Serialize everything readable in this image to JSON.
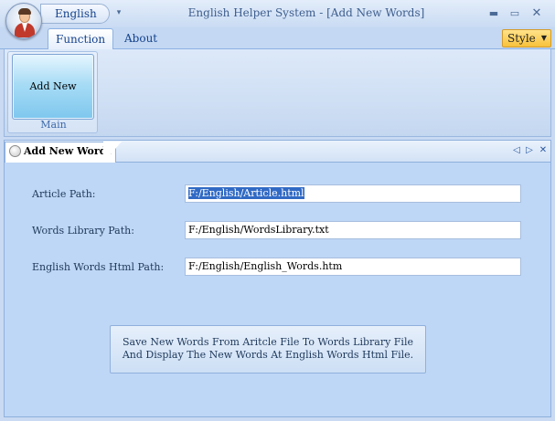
{
  "window": {
    "title": "English Helper System - [Add New Words]",
    "minimize_icon": "minimize-icon",
    "maximize_icon": "maximize-icon",
    "close_icon": "close-icon"
  },
  "quick_access": {
    "language_label": "English",
    "dropdown_icon": "customize-arrow-icon"
  },
  "ribbon": {
    "tabs": [
      {
        "label": "Function",
        "active": true
      },
      {
        "label": "About",
        "active": false
      }
    ],
    "style_button": {
      "label": "Style",
      "icon": "dropdown-caret-icon"
    },
    "groups": [
      {
        "label": "Main",
        "buttons": [
          {
            "label": "Add New Words"
          }
        ]
      }
    ]
  },
  "document": {
    "tab_label": "Add New Words",
    "tab_icon": "document-icon",
    "controls": {
      "prev": "◁",
      "next": "▷",
      "close": "✕"
    },
    "fields": [
      {
        "label": "Article Path:",
        "value": "F:/English/Article.html"
      },
      {
        "label": "Words Library Path:",
        "value": "F:/English/WordsLibrary.txt"
      },
      {
        "label": "English Words Html Path:",
        "value": "F:/English/English_Words.htm"
      }
    ],
    "action_button": {
      "line1": "Save New Words From Aritcle File To Words Library File",
      "line2": "And Display The New Words At English Words Html File."
    }
  },
  "colors": {
    "background": "#c9daf2",
    "accent": "#15428b",
    "style_button": "#f8c23b",
    "selection": "#316ac5"
  }
}
